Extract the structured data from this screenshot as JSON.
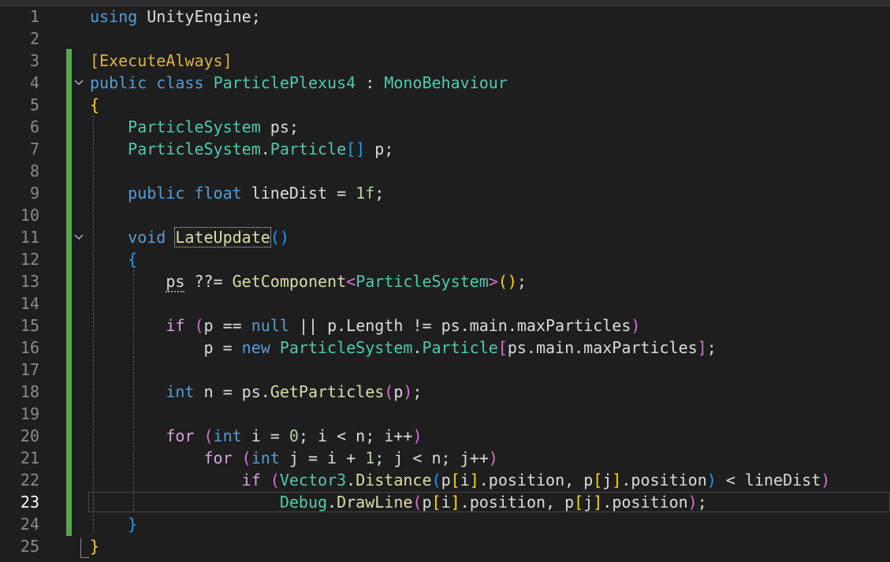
{
  "editor": {
    "current_line": 23,
    "line_numbers": [
      "1",
      "2",
      "3",
      "4",
      "5",
      "6",
      "7",
      "8",
      "9",
      "10",
      "11",
      "12",
      "13",
      "14",
      "15",
      "16",
      "17",
      "18",
      "19",
      "20",
      "21",
      "22",
      "23",
      "24",
      "25"
    ],
    "code": {
      "l1": {
        "t1": "using",
        "t2": " UnityEngine;"
      },
      "l3": {
        "t1": "[ExecuteAlways]"
      },
      "l4": {
        "t1": "public",
        "t2": " ",
        "t3": "class",
        "t4": " ",
        "t5": "ParticlePlexus4",
        "t6": " : ",
        "t7": "MonoBehaviour"
      },
      "l5": {
        "t1": "{"
      },
      "l6": {
        "t1": "    ",
        "t2": "ParticleSystem",
        "t3": " ps;"
      },
      "l7": {
        "t1": "    ",
        "t2": "ParticleSystem",
        "t3": ".",
        "t4": "Particle",
        "t5": "[]",
        "t6": " p;"
      },
      "l9": {
        "t1": "    ",
        "t2": "public",
        "t3": " ",
        "t4": "float",
        "t5": " lineDist = ",
        "t6": "1f",
        "t7": ";"
      },
      "l11": {
        "t1": "    ",
        "t2": "void",
        "t3": " ",
        "t4": "LateUpdate",
        "t5": "()"
      },
      "l12": {
        "t1": "    ",
        "t2": "{"
      },
      "l13": {
        "t1": "        ",
        "t2": "ps",
        "t3": " ??= ",
        "t4": "GetComponent",
        "t5": "<",
        "t6": "ParticleSystem",
        "t7": ">",
        "t8": "()",
        "t9": ";"
      },
      "l15": {
        "t1": "        ",
        "t2": "if",
        "t3": " ",
        "t4": "(",
        "t5": "p == ",
        "t6": "null",
        "t7": " || p.Length != ps.main.maxParticles",
        "t8": ")"
      },
      "l16": {
        "t1": "            p = ",
        "t2": "new",
        "t3": " ",
        "t4": "ParticleSystem",
        "t5": ".",
        "t6": "Particle",
        "t7": "[",
        "t8": "ps.main.maxParticles",
        "t9": "]",
        "t10": ";"
      },
      "l18": {
        "t1": "        ",
        "t2": "int",
        "t3": " n = ps.",
        "t4": "GetParticles",
        "t5": "(",
        "t6": "p",
        "t7": ")",
        "t8": ";"
      },
      "l20": {
        "t1": "        ",
        "t2": "for",
        "t3": " ",
        "t4": "(",
        "t5": "int",
        "t6": " i = ",
        "t7": "0",
        "t8": "; i < n; i++",
        "t9": ")"
      },
      "l21": {
        "t1": "            ",
        "t2": "for",
        "t3": " ",
        "t4": "(",
        "t5": "int",
        "t6": " j = i + ",
        "t7": "1",
        "t8": "; j < n; j++",
        "t9": ")"
      },
      "l22": {
        "t1": "                ",
        "t2": "if",
        "t3": " ",
        "t4": "(",
        "t5": "Vector3",
        "t6": ".",
        "t7": "Distance",
        "t8": "(",
        "t9": "p",
        "t10": "[",
        "t11": "i",
        "t12": "]",
        "t13": ".position, p",
        "t14": "[",
        "t15": "j",
        "t16": "]",
        "t17": ".position",
        "t18": ")",
        "t19": " < lineDist",
        "t20": ")"
      },
      "l23": {
        "t1": "                    ",
        "t2": "Debug",
        "t3": ".",
        "t4": "DrawLine",
        "t5": "(",
        "t6": "p",
        "t7": "[",
        "t8": "i",
        "t9": "]",
        "t10": ".position, p",
        "t11": "[",
        "t12": "j",
        "t13": "]",
        "t14": ".position",
        "t15": ")",
        "t16": ";"
      },
      "l24": {
        "t1": "    ",
        "t2": "}"
      },
      "l25": {
        "t1": "}"
      }
    }
  }
}
